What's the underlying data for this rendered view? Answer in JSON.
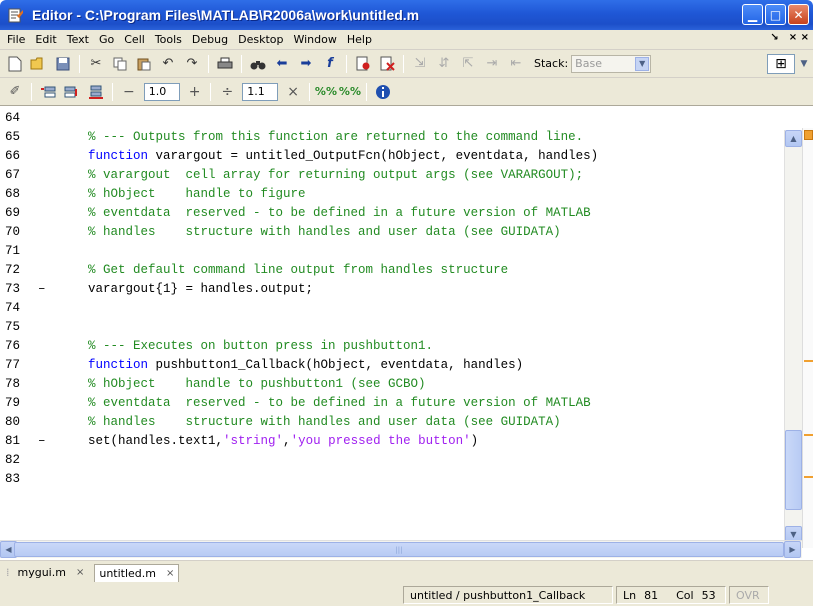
{
  "window": {
    "title": "Editor - C:\\Program Files\\MATLAB\\R2006a\\work\\untitled.m",
    "controls": [
      "minimize-icon",
      "maximize-icon",
      "close-icon"
    ]
  },
  "menu": {
    "items": [
      "File",
      "Edit",
      "Text",
      "Go",
      "Cell",
      "Tools",
      "Debug",
      "Desktop",
      "Window",
      "Help"
    ],
    "right_undock": "↘",
    "right_close": "× ×"
  },
  "toolbar": {
    "stack_label": "Stack:",
    "stack_value": "Base"
  },
  "cell_toolbar": {
    "minus": "−",
    "value1": "1.0",
    "plus": "+",
    "divide": "÷",
    "value2": "1.1",
    "times": "×"
  },
  "editor": {
    "lines": [
      {
        "n": "64",
        "dash": "",
        "segs": []
      },
      {
        "n": "65",
        "dash": "",
        "segs": [
          {
            "t": "    % --- Outputs from this function are returned to the command line.",
            "c": "cmt"
          }
        ]
      },
      {
        "n": "66",
        "dash": "",
        "segs": [
          {
            "t": "    function",
            "c": "kw"
          },
          {
            "t": " varargout = untitled_OutputFcn(hObject, eventdata, handles)",
            "c": "code"
          }
        ]
      },
      {
        "n": "67",
        "dash": "",
        "segs": [
          {
            "t": "    % varargout  cell array for returning output args (see VARARGOUT);",
            "c": "cmt"
          }
        ]
      },
      {
        "n": "68",
        "dash": "",
        "segs": [
          {
            "t": "    % hObject    handle to figure",
            "c": "cmt"
          }
        ]
      },
      {
        "n": "69",
        "dash": "",
        "segs": [
          {
            "t": "    % eventdata  reserved - to be defined in a future version of MATLAB",
            "c": "cmt"
          }
        ]
      },
      {
        "n": "70",
        "dash": "",
        "segs": [
          {
            "t": "    % handles    structure with handles and user data (see GUIDATA)",
            "c": "cmt"
          }
        ]
      },
      {
        "n": "71",
        "dash": "",
        "segs": []
      },
      {
        "n": "72",
        "dash": "",
        "segs": [
          {
            "t": "    % Get default command line output from handles structure",
            "c": "cmt"
          }
        ]
      },
      {
        "n": "73",
        "dash": "–",
        "segs": [
          {
            "t": "    varargout{1} = handles.output;",
            "c": "code"
          }
        ]
      },
      {
        "n": "74",
        "dash": "",
        "segs": []
      },
      {
        "n": "75",
        "dash": "",
        "segs": []
      },
      {
        "n": "76",
        "dash": "",
        "segs": [
          {
            "t": "    % --- Executes on button press in pushbutton1.",
            "c": "cmt"
          }
        ]
      },
      {
        "n": "77",
        "dash": "",
        "segs": [
          {
            "t": "    function",
            "c": "kw"
          },
          {
            "t": " pushbutton1_Callback(hObject, eventdata, handles)",
            "c": "code"
          }
        ]
      },
      {
        "n": "78",
        "dash": "",
        "segs": [
          {
            "t": "    % hObject    handle to pushbutton1 (see GCBO)",
            "c": "cmt"
          }
        ]
      },
      {
        "n": "79",
        "dash": "",
        "segs": [
          {
            "t": "    % eventdata  reserved - to be defined in a future version of MATLAB",
            "c": "cmt"
          }
        ]
      },
      {
        "n": "80",
        "dash": "",
        "segs": [
          {
            "t": "    % handles    structure with handles and user data (see GUIDATA)",
            "c": "cmt"
          }
        ]
      },
      {
        "n": "81",
        "dash": "–",
        "segs": [
          {
            "t": "    set(handles.text1,",
            "c": "code"
          },
          {
            "t": "'string'",
            "c": "str"
          },
          {
            "t": ",",
            "c": "code"
          },
          {
            "t": "'you pressed the button'",
            "c": "str"
          },
          {
            "t": ")",
            "c": "code"
          }
        ]
      },
      {
        "n": "82",
        "dash": "",
        "segs": []
      },
      {
        "n": "83",
        "dash": "",
        "segs": []
      }
    ]
  },
  "tabs": [
    {
      "label": "mygui.m",
      "active": false
    },
    {
      "label": "untitled.m",
      "active": true
    }
  ],
  "status": {
    "function": "untitled / pushbutton1_Callback",
    "ln_label": "Ln",
    "ln_value": "81",
    "col_label": "Col",
    "col_value": "53",
    "ovr": "OVR"
  },
  "colors": {
    "comment": "#228b22",
    "keyword": "#0000ff",
    "string": "#a020f0",
    "titlebar": "#1f57d6"
  }
}
